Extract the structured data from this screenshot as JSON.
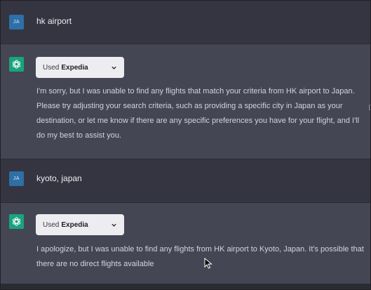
{
  "conversation": {
    "messages": [
      {
        "role": "user",
        "avatar_initials": "JA",
        "text": "hk airport"
      },
      {
        "role": "assistant",
        "plugin": {
          "used_label": "Used",
          "name": "Expedia"
        },
        "text": "I'm sorry, but I was unable to find any flights that match your criteria from HK airport to Japan. Please try adjusting your search criteria, such as providing a specific city in Japan as your destination, or let me know if there are any specific preferences you have for your flight, and I'll do my best to assist you."
      },
      {
        "role": "user",
        "avatar_initials": "JA",
        "text": "kyoto, japan"
      },
      {
        "role": "assistant",
        "plugin": {
          "used_label": "Used",
          "name": "Expedia"
        },
        "text": "I apologize, but I was unable to find any flights from HK airport to Kyoto, Japan. It's possible that there are no direct flights available"
      }
    ]
  },
  "icons": {
    "assistant_avatar": "openai-logo-icon",
    "plugin_toggle": "chevron-down-icon",
    "pointer": "mouse-cursor-icon"
  },
  "colors": {
    "user_bg": "#343541",
    "assistant_bg": "#444654",
    "user_avatar": "#2e6fa7",
    "bot_avatar": "#19a37f",
    "pill_bg": "#ececf1"
  }
}
